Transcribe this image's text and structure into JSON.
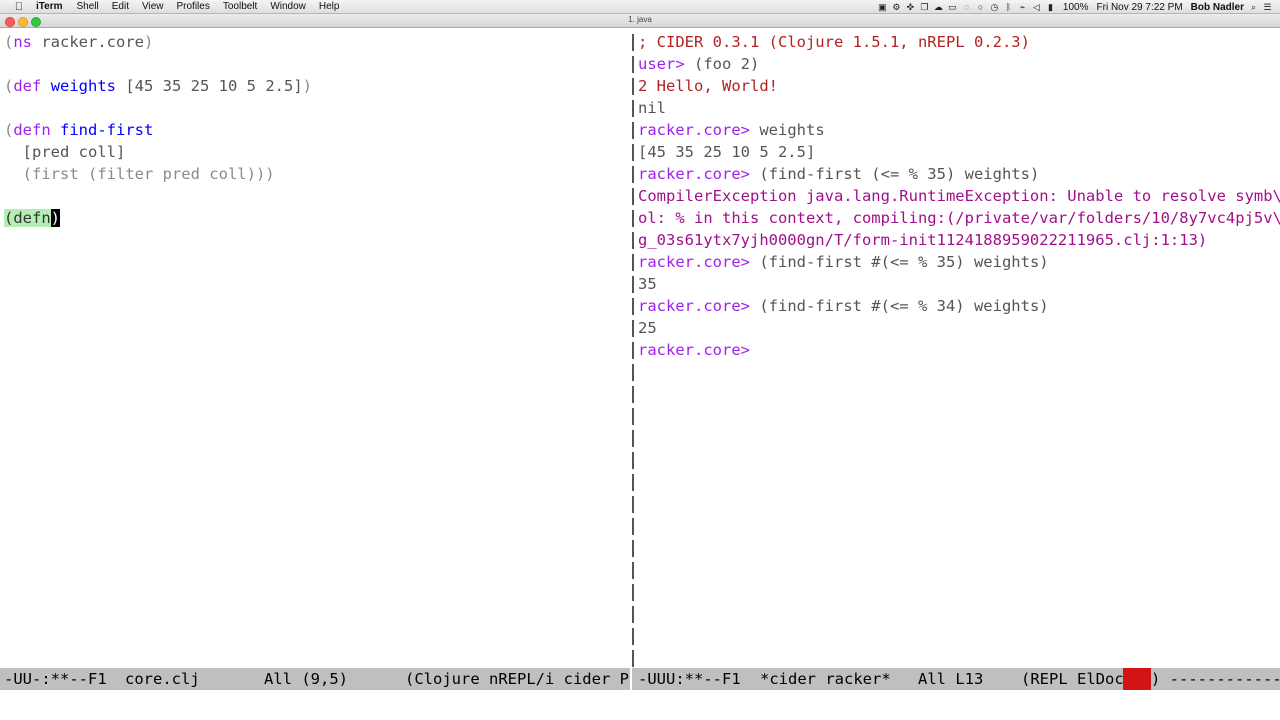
{
  "menubar": {
    "apple_icon": "apple-icon",
    "items": [
      "iTerm",
      "Shell",
      "Edit",
      "View",
      "Profiles",
      "Toolbelt",
      "Window",
      "Help"
    ],
    "battery": "100%",
    "datetime": "Fri Nov 29  7:22 PM",
    "user": "Bob Nadler",
    "tray_icons": [
      "camera-icon",
      "gear-icon",
      "move-icon",
      "copy-icon",
      "cloud-icon",
      "display-icon",
      "chat-icon",
      "circle-icon",
      "clock-icon",
      "bluetooth-icon",
      "wifi-icon",
      "volume-icon",
      "battery-icon",
      "search-icon",
      "list-icon"
    ]
  },
  "window": {
    "title": "1. java"
  },
  "left_buffer": {
    "lines": [
      [
        {
          "t": "(",
          "c": "paren"
        },
        {
          "t": "ns",
          "c": "kw"
        },
        {
          "t": " racker.core",
          "c": "dim"
        },
        {
          "t": ")",
          "c": "paren"
        }
      ],
      [],
      [
        {
          "t": "(",
          "c": "paren"
        },
        {
          "t": "def",
          "c": "kw"
        },
        {
          "t": " ",
          "c": ""
        },
        {
          "t": "weights",
          "c": "fn"
        },
        {
          "t": " [45 35 25 10 5 2.5]",
          "c": "dim"
        },
        {
          "t": ")",
          "c": "paren"
        }
      ],
      [],
      [
        {
          "t": "(",
          "c": "paren"
        },
        {
          "t": "defn",
          "c": "kw"
        },
        {
          "t": " ",
          "c": ""
        },
        {
          "t": "find-first",
          "c": "fn"
        }
      ],
      [
        {
          "t": "  [pred coll]",
          "c": "dim"
        }
      ],
      [
        {
          "t": "  (first (filter pred coll)))",
          "c": "paren"
        }
      ],
      [],
      [
        {
          "t": "(defn",
          "c": "match"
        },
        {
          "t": ")",
          "c": "cursor"
        }
      ]
    ]
  },
  "right_buffer": {
    "lines": [
      [
        {
          "t": "; CIDER 0.3.1 (Clojure 1.5.1, nREPL 0.2.3)",
          "c": "cider"
        }
      ],
      [
        {
          "t": "user> ",
          "c": "prompt"
        },
        {
          "t": "(foo 2)",
          "c": "dim"
        }
      ],
      [
        {
          "t": "2 Hello, World!",
          "c": "cider"
        }
      ],
      [
        {
          "t": "nil",
          "c": "out-nil"
        }
      ],
      [
        {
          "t": "racker.core> ",
          "c": "prompt"
        },
        {
          "t": "weights",
          "c": "dim"
        }
      ],
      [
        {
          "t": "[45 35 25 10 5 2.5]",
          "c": "dim"
        }
      ],
      [
        {
          "t": "racker.core> ",
          "c": "prompt"
        },
        {
          "t": "(find-first (<= % 35) weights)",
          "c": "dim"
        }
      ],
      [
        {
          "t": "CompilerException java.lang.RuntimeException: Unable to resolve symb\\",
          "c": "out-red"
        }
      ],
      [
        {
          "t": "ol: % in this context, compiling:(/private/var/folders/10/8y7vc4pj5v\\",
          "c": "out-red"
        }
      ],
      [
        {
          "t": "g_03s61ytx7yjh0000gn/T/form-init1124188959022211965.clj:1:13)",
          "c": "out-red"
        }
      ],
      [
        {
          "t": "racker.core> ",
          "c": "prompt"
        },
        {
          "t": "(find-first #(<= % 35) weights)",
          "c": "dim"
        }
      ],
      [
        {
          "t": "35",
          "c": "out-nil"
        }
      ],
      [
        {
          "t": "racker.core> ",
          "c": "prompt"
        },
        {
          "t": "(find-first #(<= % 34) weights)",
          "c": "dim"
        }
      ],
      [
        {
          "t": "25",
          "c": "out-nil"
        }
      ],
      [
        {
          "t": "racker.core> ",
          "c": "prompt"
        }
      ]
    ]
  },
  "left_modeline": {
    "status": "-UU-:**--F1",
    "buffer": "core.clj",
    "position": "All (9,5)",
    "mode": "(Clojure nREPL/i cider P"
  },
  "right_modeline": {
    "status": "-UUU:**--F1",
    "buffer": "*cider racker*",
    "position": "All L13",
    "mode": "(REPL ElDoc",
    "mode_end": ") -------------"
  }
}
